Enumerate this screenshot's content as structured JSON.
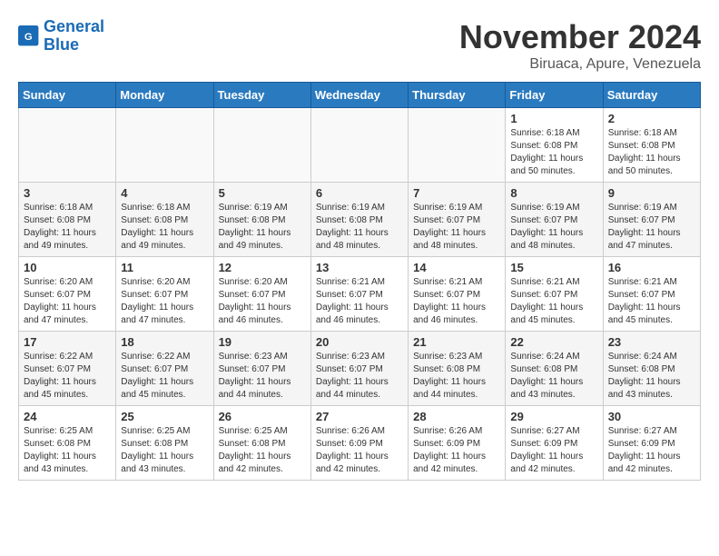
{
  "header": {
    "logo_line1": "General",
    "logo_line2": "Blue",
    "month_title": "November 2024",
    "subtitle": "Biruaca, Apure, Venezuela"
  },
  "weekdays": [
    "Sunday",
    "Monday",
    "Tuesday",
    "Wednesday",
    "Thursday",
    "Friday",
    "Saturday"
  ],
  "weeks": [
    [
      {
        "day": "",
        "info": ""
      },
      {
        "day": "",
        "info": ""
      },
      {
        "day": "",
        "info": ""
      },
      {
        "day": "",
        "info": ""
      },
      {
        "day": "",
        "info": ""
      },
      {
        "day": "1",
        "info": "Sunrise: 6:18 AM\nSunset: 6:08 PM\nDaylight: 11 hours\nand 50 minutes."
      },
      {
        "day": "2",
        "info": "Sunrise: 6:18 AM\nSunset: 6:08 PM\nDaylight: 11 hours\nand 50 minutes."
      }
    ],
    [
      {
        "day": "3",
        "info": "Sunrise: 6:18 AM\nSunset: 6:08 PM\nDaylight: 11 hours\nand 49 minutes."
      },
      {
        "day": "4",
        "info": "Sunrise: 6:18 AM\nSunset: 6:08 PM\nDaylight: 11 hours\nand 49 minutes."
      },
      {
        "day": "5",
        "info": "Sunrise: 6:19 AM\nSunset: 6:08 PM\nDaylight: 11 hours\nand 49 minutes."
      },
      {
        "day": "6",
        "info": "Sunrise: 6:19 AM\nSunset: 6:08 PM\nDaylight: 11 hours\nand 48 minutes."
      },
      {
        "day": "7",
        "info": "Sunrise: 6:19 AM\nSunset: 6:07 PM\nDaylight: 11 hours\nand 48 minutes."
      },
      {
        "day": "8",
        "info": "Sunrise: 6:19 AM\nSunset: 6:07 PM\nDaylight: 11 hours\nand 48 minutes."
      },
      {
        "day": "9",
        "info": "Sunrise: 6:19 AM\nSunset: 6:07 PM\nDaylight: 11 hours\nand 47 minutes."
      }
    ],
    [
      {
        "day": "10",
        "info": "Sunrise: 6:20 AM\nSunset: 6:07 PM\nDaylight: 11 hours\nand 47 minutes."
      },
      {
        "day": "11",
        "info": "Sunrise: 6:20 AM\nSunset: 6:07 PM\nDaylight: 11 hours\nand 47 minutes."
      },
      {
        "day": "12",
        "info": "Sunrise: 6:20 AM\nSunset: 6:07 PM\nDaylight: 11 hours\nand 46 minutes."
      },
      {
        "day": "13",
        "info": "Sunrise: 6:21 AM\nSunset: 6:07 PM\nDaylight: 11 hours\nand 46 minutes."
      },
      {
        "day": "14",
        "info": "Sunrise: 6:21 AM\nSunset: 6:07 PM\nDaylight: 11 hours\nand 46 minutes."
      },
      {
        "day": "15",
        "info": "Sunrise: 6:21 AM\nSunset: 6:07 PM\nDaylight: 11 hours\nand 45 minutes."
      },
      {
        "day": "16",
        "info": "Sunrise: 6:21 AM\nSunset: 6:07 PM\nDaylight: 11 hours\nand 45 minutes."
      }
    ],
    [
      {
        "day": "17",
        "info": "Sunrise: 6:22 AM\nSunset: 6:07 PM\nDaylight: 11 hours\nand 45 minutes."
      },
      {
        "day": "18",
        "info": "Sunrise: 6:22 AM\nSunset: 6:07 PM\nDaylight: 11 hours\nand 45 minutes."
      },
      {
        "day": "19",
        "info": "Sunrise: 6:23 AM\nSunset: 6:07 PM\nDaylight: 11 hours\nand 44 minutes."
      },
      {
        "day": "20",
        "info": "Sunrise: 6:23 AM\nSunset: 6:07 PM\nDaylight: 11 hours\nand 44 minutes."
      },
      {
        "day": "21",
        "info": "Sunrise: 6:23 AM\nSunset: 6:08 PM\nDaylight: 11 hours\nand 44 minutes."
      },
      {
        "day": "22",
        "info": "Sunrise: 6:24 AM\nSunset: 6:08 PM\nDaylight: 11 hours\nand 43 minutes."
      },
      {
        "day": "23",
        "info": "Sunrise: 6:24 AM\nSunset: 6:08 PM\nDaylight: 11 hours\nand 43 minutes."
      }
    ],
    [
      {
        "day": "24",
        "info": "Sunrise: 6:25 AM\nSunset: 6:08 PM\nDaylight: 11 hours\nand 43 minutes."
      },
      {
        "day": "25",
        "info": "Sunrise: 6:25 AM\nSunset: 6:08 PM\nDaylight: 11 hours\nand 43 minutes."
      },
      {
        "day": "26",
        "info": "Sunrise: 6:25 AM\nSunset: 6:08 PM\nDaylight: 11 hours\nand 42 minutes."
      },
      {
        "day": "27",
        "info": "Sunrise: 6:26 AM\nSunset: 6:09 PM\nDaylight: 11 hours\nand 42 minutes."
      },
      {
        "day": "28",
        "info": "Sunrise: 6:26 AM\nSunset: 6:09 PM\nDaylight: 11 hours\nand 42 minutes."
      },
      {
        "day": "29",
        "info": "Sunrise: 6:27 AM\nSunset: 6:09 PM\nDaylight: 11 hours\nand 42 minutes."
      },
      {
        "day": "30",
        "info": "Sunrise: 6:27 AM\nSunset: 6:09 PM\nDaylight: 11 hours\nand 42 minutes."
      }
    ]
  ]
}
